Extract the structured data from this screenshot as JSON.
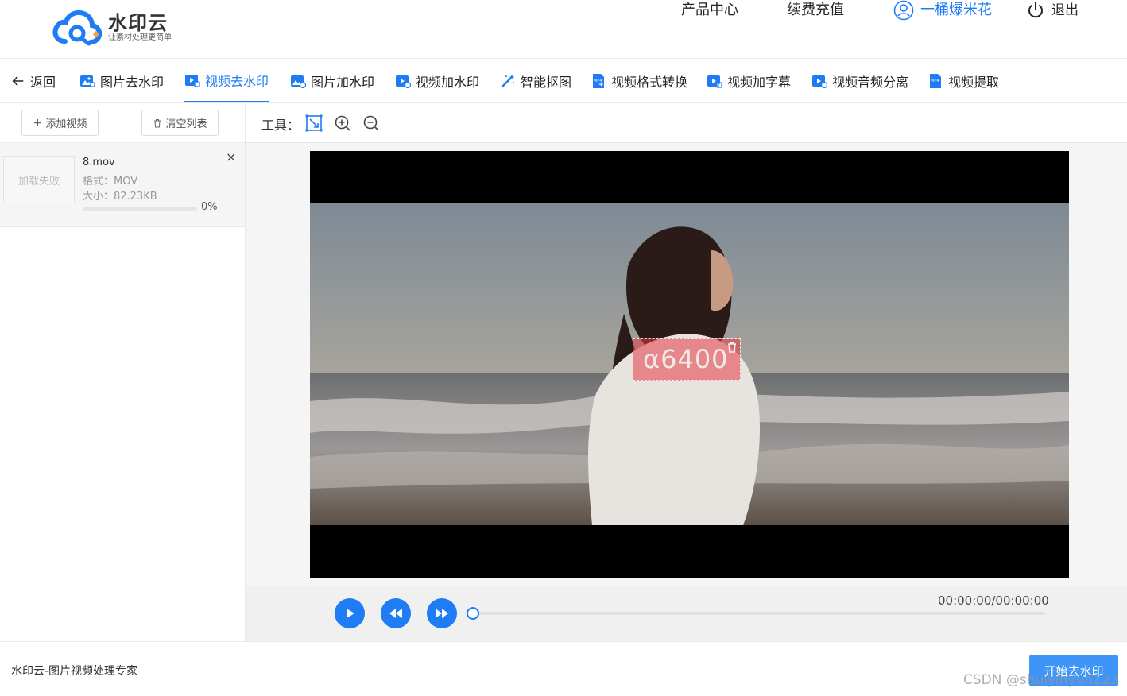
{
  "brand": {
    "name": "水印云",
    "tagline": "让素材处理更简单",
    "colors": {
      "accent": "#1e7cf5",
      "logo_orange": "#f7a23b"
    }
  },
  "topnav": {
    "products": "产品中心",
    "recharge": "续费充值",
    "username": "一桶爆米花",
    "logout": "退出"
  },
  "tabs": [
    {
      "label": "返回",
      "icon": "arrow-left-icon"
    },
    {
      "label": "图片去水印",
      "icon": "image-icon"
    },
    {
      "label": "视频去水印",
      "icon": "video-icon",
      "active": true
    },
    {
      "label": "图片加水印",
      "icon": "image-add-icon"
    },
    {
      "label": "视频加水印",
      "icon": "video-add-icon"
    },
    {
      "label": "智能抠图",
      "icon": "magic-wand-icon"
    },
    {
      "label": "视频格式转换",
      "icon": "mp4-file-icon"
    },
    {
      "label": "视频加字幕",
      "icon": "subtitle-icon"
    },
    {
      "label": "视频音频分离",
      "icon": "audio-split-icon"
    },
    {
      "label": "视频提取",
      "icon": "mp4-extract-icon"
    }
  ],
  "sidebar": {
    "add_video": "添加视频",
    "clear_list": "清空列表",
    "file": {
      "thumb_text": "加载失败",
      "name": "8.mov",
      "format": "格式：MOV",
      "size": "大小：82.23KB",
      "progress_text": "0%",
      "progress": 0
    }
  },
  "tools": {
    "label": "工具：",
    "icons": [
      "select-area-icon",
      "zoom-in-icon",
      "zoom-out-icon"
    ]
  },
  "video": {
    "watermark_text": "α6400"
  },
  "player": {
    "timecode": "00:00:00/00:00:00",
    "position": 0
  },
  "footer": {
    "slogan": "水印云-图片视频处理专家",
    "start_button": "开始去水印",
    "page_watermark": "CSDN @shuiyinyun123"
  }
}
